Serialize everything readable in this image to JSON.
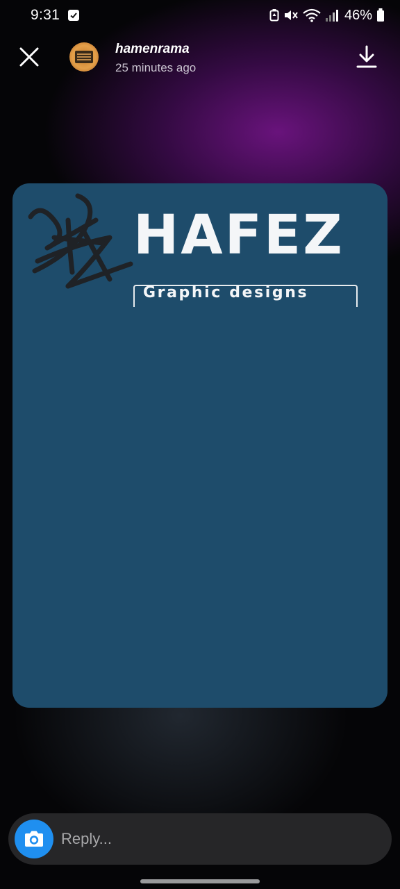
{
  "status_bar": {
    "time": "9:31",
    "battery": "46%",
    "icons": [
      "checkbox-icon",
      "battery-saver-icon",
      "mute-icon",
      "wifi-icon",
      "signal-icon",
      "battery-icon"
    ]
  },
  "header": {
    "username": "hamenrama",
    "timestamp": "25 minutes ago",
    "close_icon": "close-icon",
    "download_icon": "download-icon"
  },
  "story": {
    "brand_title": "HAFEZ",
    "brand_subtitle": "Graphic designs",
    "background_color": "#1e4c6b"
  },
  "reply": {
    "placeholder": "Reply...",
    "camera_icon": "camera-icon",
    "accent_color": "#1f8ff0"
  }
}
